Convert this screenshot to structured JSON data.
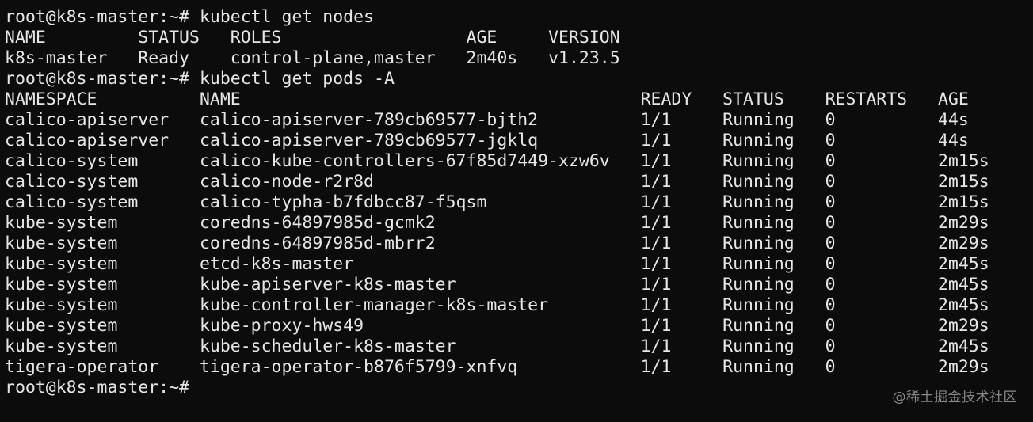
{
  "prompt": "root@k8s-master:~#",
  "commands": {
    "get_nodes": "kubectl get nodes",
    "get_pods": "kubectl get pods -A"
  },
  "nodes_table": {
    "headers": [
      "NAME",
      "STATUS",
      "ROLES",
      "AGE",
      "VERSION"
    ],
    "rows": [
      [
        "k8s-master",
        "Ready",
        "control-plane,master",
        "2m40s",
        "v1.23.5"
      ]
    ]
  },
  "pods_table": {
    "headers": [
      "NAMESPACE",
      "NAME",
      "READY",
      "STATUS",
      "RESTARTS",
      "AGE"
    ],
    "rows": [
      [
        "calico-apiserver",
        "calico-apiserver-789cb69577-bjth2",
        "1/1",
        "Running",
        "0",
        "44s"
      ],
      [
        "calico-apiserver",
        "calico-apiserver-789cb69577-jgklq",
        "1/1",
        "Running",
        "0",
        "44s"
      ],
      [
        "calico-system",
        "calico-kube-controllers-67f85d7449-xzw6v",
        "1/1",
        "Running",
        "0",
        "2m15s"
      ],
      [
        "calico-system",
        "calico-node-r2r8d",
        "1/1",
        "Running",
        "0",
        "2m15s"
      ],
      [
        "calico-system",
        "calico-typha-b7fdbcc87-f5qsm",
        "1/1",
        "Running",
        "0",
        "2m15s"
      ],
      [
        "kube-system",
        "coredns-64897985d-gcmk2",
        "1/1",
        "Running",
        "0",
        "2m29s"
      ],
      [
        "kube-system",
        "coredns-64897985d-mbrr2",
        "1/1",
        "Running",
        "0",
        "2m29s"
      ],
      [
        "kube-system",
        "etcd-k8s-master",
        "1/1",
        "Running",
        "0",
        "2m45s"
      ],
      [
        "kube-system",
        "kube-apiserver-k8s-master",
        "1/1",
        "Running",
        "0",
        "2m45s"
      ],
      [
        "kube-system",
        "kube-controller-manager-k8s-master",
        "1/1",
        "Running",
        "0",
        "2m45s"
      ],
      [
        "kube-system",
        "kube-proxy-hws49",
        "1/1",
        "Running",
        "0",
        "2m29s"
      ],
      [
        "kube-system",
        "kube-scheduler-k8s-master",
        "1/1",
        "Running",
        "0",
        "2m45s"
      ],
      [
        "tigera-operator",
        "tigera-operator-b876f5799-xnfvq",
        "1/1",
        "Running",
        "0",
        "2m29s"
      ]
    ]
  },
  "watermark": "@稀土掘金技术社区",
  "colors": {
    "background": "#0c0c0c",
    "foreground": "#e6e6e6",
    "watermark": "#8a8a8a"
  }
}
